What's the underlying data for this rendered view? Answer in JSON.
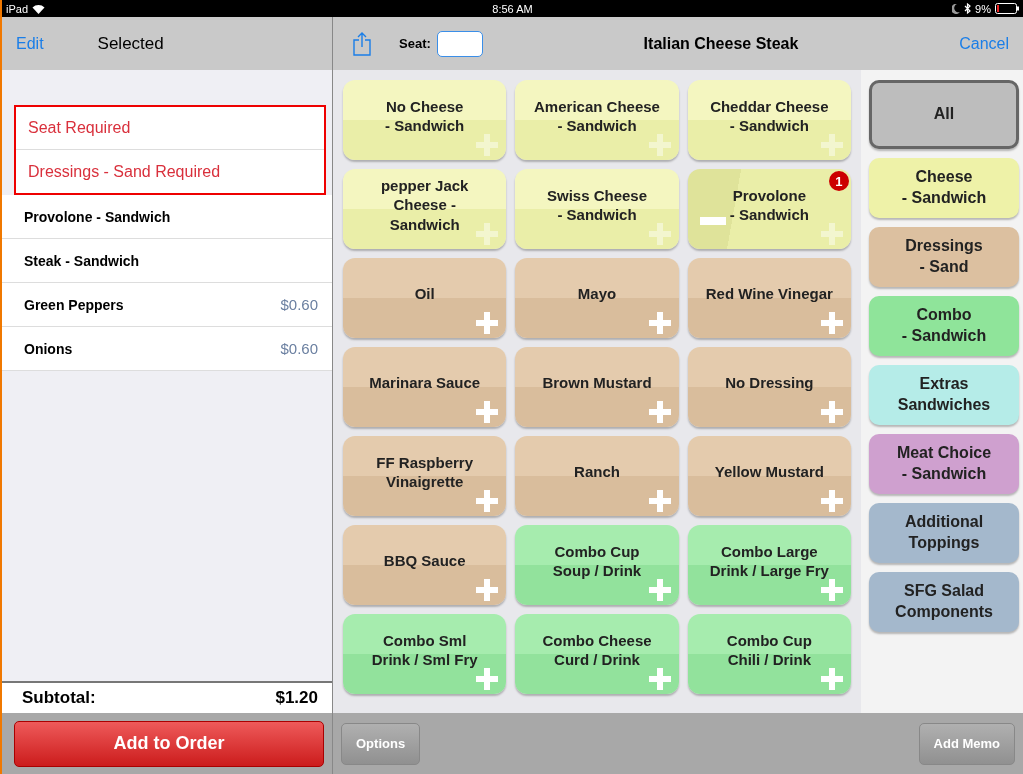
{
  "status_bar": {
    "carrier": "iPad",
    "time": "8:56 AM",
    "battery": "9%"
  },
  "left_nav": {
    "edit": "Edit",
    "title": "Selected"
  },
  "required": [
    "Seat Required",
    "Dressings - Sand Required"
  ],
  "selected_items": [
    {
      "name": "Provolone - Sandwich"
    },
    {
      "name": "Steak - Sandwich"
    },
    {
      "name": "Green Peppers",
      "price": "$0.60"
    },
    {
      "name": "Onions",
      "price": "$0.60"
    }
  ],
  "subtotal": {
    "label": "Subtotal:",
    "value": "$1.20"
  },
  "add_button": "Add to Order",
  "nav": {
    "seat_label": "Seat:",
    "title": "Italian Cheese Steak",
    "cancel": "Cancel"
  },
  "modifiers": [
    {
      "label": "No Cheese\n- Sandwich",
      "kind": "cheese",
      "selected": false
    },
    {
      "label": "American Cheese\n- Sandwich",
      "kind": "cheese",
      "selected": false
    },
    {
      "label": "Cheddar Cheese\n- Sandwich",
      "kind": "cheese",
      "selected": false
    },
    {
      "label": "pepper Jack\nCheese -\nSandwich",
      "kind": "cheese",
      "selected": false
    },
    {
      "label": "Swiss Cheese\n- Sandwich",
      "kind": "cheese",
      "selected": false
    },
    {
      "label": "Provolone\n- Sandwich",
      "kind": "cheese",
      "selected": true,
      "count": "1"
    },
    {
      "label": "Oil",
      "kind": "dressing",
      "selected": false
    },
    {
      "label": "Mayo",
      "kind": "dressing",
      "selected": false
    },
    {
      "label": "Red Wine Vinegar",
      "kind": "dressing",
      "selected": false
    },
    {
      "label": "Marinara Sauce",
      "kind": "dressing",
      "selected": false
    },
    {
      "label": "Brown Mustard",
      "kind": "dressing",
      "selected": false
    },
    {
      "label": "No Dressing",
      "kind": "dressing",
      "selected": false
    },
    {
      "label": "FF Raspberry\nVinaigrette",
      "kind": "dressing",
      "selected": false
    },
    {
      "label": "Ranch",
      "kind": "dressing",
      "selected": false
    },
    {
      "label": "Yellow Mustard",
      "kind": "dressing",
      "selected": false
    },
    {
      "label": "BBQ Sauce",
      "kind": "dressing",
      "selected": false
    },
    {
      "label": "Combo Cup\nSoup / Drink",
      "kind": "combo",
      "selected": false
    },
    {
      "label": "Combo Large\nDrink / Large Fry",
      "kind": "combo",
      "selected": false
    },
    {
      "label": "Combo Sml\nDrink / Sml Fry",
      "kind": "combo",
      "selected": false
    },
    {
      "label": "Combo Cheese\nCurd / Drink",
      "kind": "combo",
      "selected": false
    },
    {
      "label": "Combo Cup\nChili / Drink",
      "kind": "combo",
      "selected": false
    }
  ],
  "categories": [
    {
      "label": "All",
      "color": "#bdbdbd",
      "selected": true
    },
    {
      "label": "Cheese\n- Sandwich",
      "color": "#eef2a8",
      "selected": false
    },
    {
      "label": "Dressings\n- Sand",
      "color": "#dcc0a0",
      "selected": false
    },
    {
      "label": "Combo\n- Sandwich",
      "color": "#8fe49a",
      "selected": false
    },
    {
      "label": "Extras\nSandwiches",
      "color": "#b5ece8",
      "selected": false
    },
    {
      "label": "Meat Choice\n- Sandwich",
      "color": "#cfa0cf",
      "selected": false
    },
    {
      "label": "Additional\nToppings",
      "color": "#a4b8cc",
      "selected": false
    },
    {
      "label": "SFG Salad\nComponents",
      "color": "#a4b8cc",
      "selected": false
    }
  ],
  "toolbar": {
    "options": "Options",
    "memo": "Add Memo"
  }
}
